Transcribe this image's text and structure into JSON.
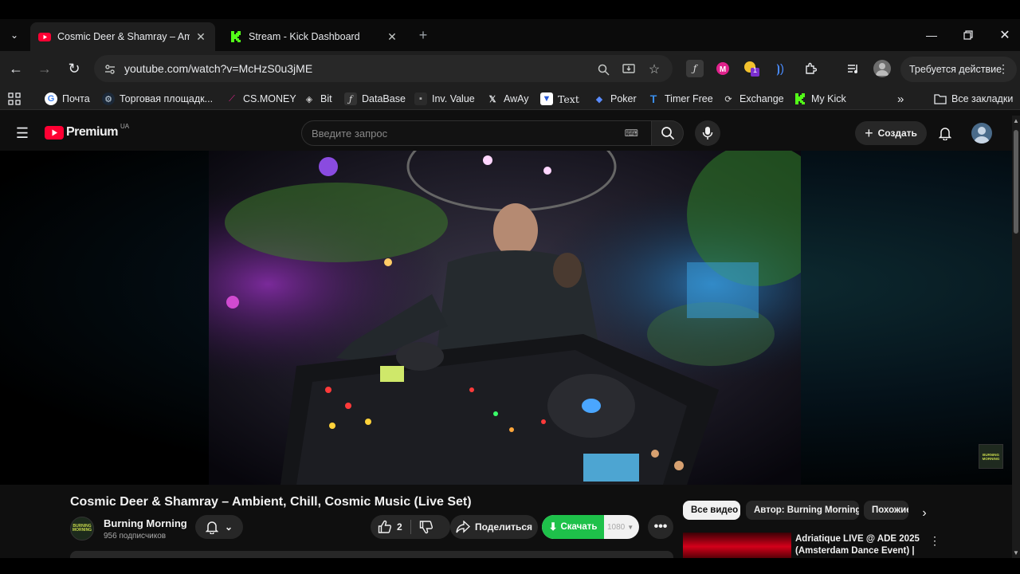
{
  "browser": {
    "tabs": [
      {
        "title": "Cosmic Deer & Shamray – Ambient, Chill, Cosmic Music (Live Set)",
        "active": true
      },
      {
        "title": "Stream - Kick Dashboard",
        "active": false
      }
    ],
    "new_tab": "+",
    "url": "youtube.com/watch?v=McHzS0u3jME",
    "action_required": "Требуется действие",
    "extension_badge": "1",
    "bookmarks": [
      "Почта",
      "Торговая площадк...",
      "CS.MONEY",
      "Bit",
      "DataBase",
      "Inv. Value",
      "AwAy",
      "Text",
      "Poker",
      "Timer Free",
      "Exchange",
      "My Kick"
    ],
    "all_bookmarks": "Все закладки"
  },
  "youtube": {
    "logo_text": "Premium",
    "logo_region": "UA",
    "search_placeholder": "Введите запрос",
    "create_label": "Создать",
    "video": {
      "title": "Cosmic Deer & Shamray – Ambient, Chill, Cosmic Music (Live Set)",
      "channel": "Burning Morning",
      "channel_logo_text": "BURNING MORNING",
      "subscribers": "956 подписчиков",
      "likes": "2",
      "share_label": "Поделиться",
      "download_label": "Скачать",
      "quality": "1080",
      "watermark_text": "BURNING MORNING"
    },
    "chips": [
      "Все видео",
      "Автор: Burning Morning",
      "Похожие"
    ],
    "recommendation": {
      "title": "Adriatique LIVE @ ADE 2025 (Amsterdam Dance Event) | ..."
    }
  },
  "colors": {
    "youtube_red": "#ff0033",
    "download_green": "#1ec14a",
    "kick_green": "#53fc18"
  }
}
